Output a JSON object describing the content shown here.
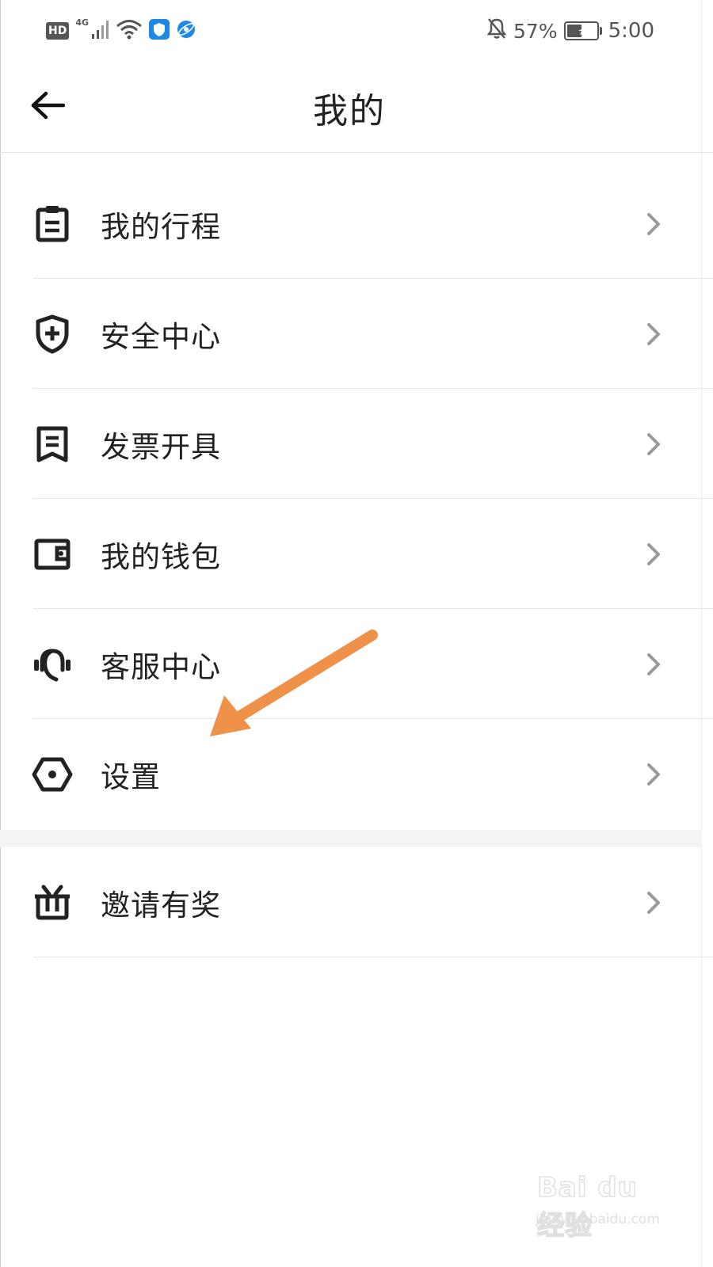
{
  "status_bar": {
    "hd": "HD",
    "network": "4G",
    "battery_percent": "57%",
    "battery_level": 0.57,
    "time": "5:00",
    "icons": [
      "hd-badge",
      "signal-icon",
      "wifi-icon",
      "shield-app-icon",
      "browser-app-icon",
      "bell-off-icon",
      "battery-charging-icon"
    ]
  },
  "header": {
    "back_icon": "arrow-left-icon",
    "title": "我的"
  },
  "menu": {
    "group1": [
      {
        "label": "我的行程",
        "icon": "clipboard-icon"
      },
      {
        "label": "安全中心",
        "icon": "shield-plus-icon"
      },
      {
        "label": "发票开具",
        "icon": "receipt-icon"
      },
      {
        "label": "我的钱包",
        "icon": "wallet-icon"
      },
      {
        "label": "客服中心",
        "icon": "headset-icon"
      },
      {
        "label": "设置",
        "icon": "hexagon-settings-icon"
      }
    ],
    "group2": [
      {
        "label": "邀请有奖",
        "icon": "gift-icon"
      }
    ]
  },
  "annotation": {
    "arrow_color": "#f0914a"
  },
  "watermark": {
    "text": "Bai du 经验",
    "sub": "jingyan.baidu.com"
  },
  "colors": {
    "text": "#222222",
    "icon": "#222222",
    "chevron": "#999999",
    "divider": "#e8e8e8",
    "section_gap": "#f4f4f4",
    "status": "#555555",
    "arrow": "#f0914a"
  }
}
